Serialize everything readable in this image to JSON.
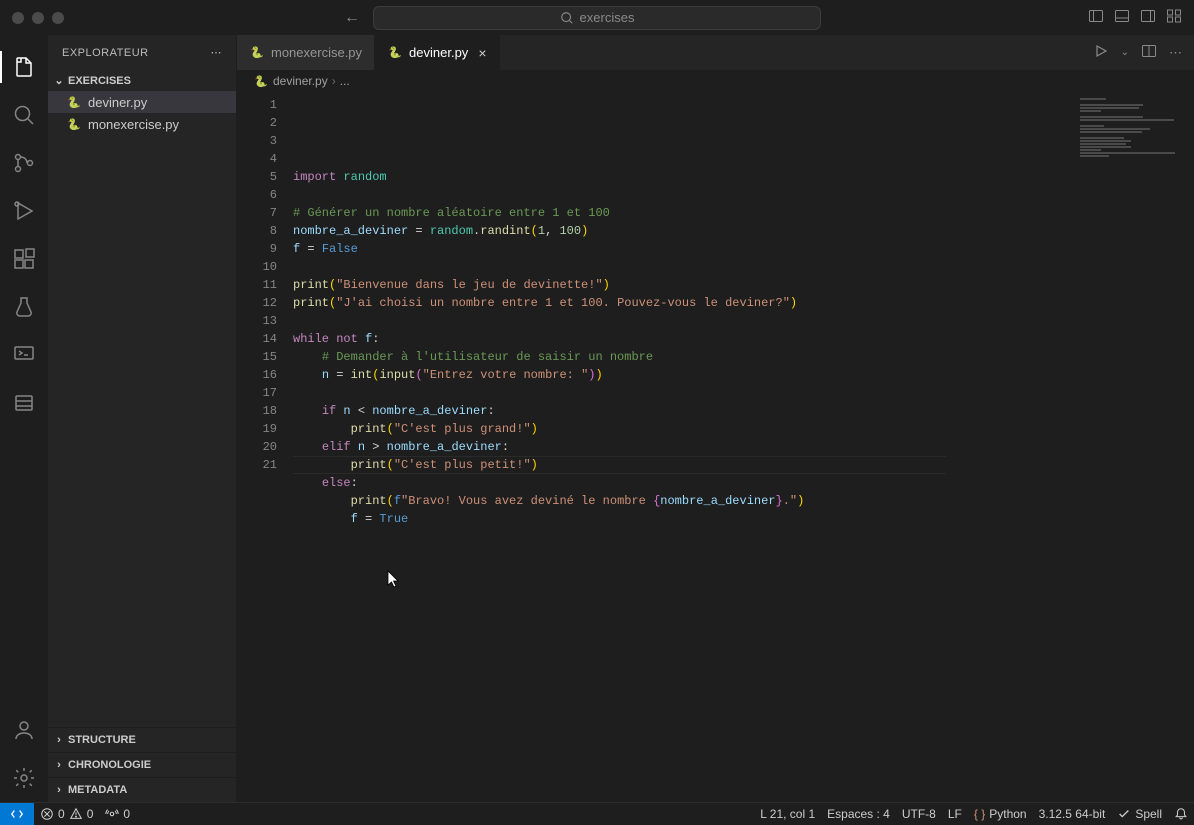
{
  "titlebar": {
    "search_placeholder": "exercises"
  },
  "sidebar": {
    "title": "EXPLORATEUR",
    "workspace": "EXERCISES",
    "files": [
      {
        "name": "deviner.py",
        "active": true
      },
      {
        "name": "monexercise.py",
        "active": false
      }
    ],
    "bottom_sections": [
      "STRUCTURE",
      "CHRONOLOGIE",
      "METADATA"
    ]
  },
  "tabs": [
    {
      "label": "monexercise.py",
      "active": false
    },
    {
      "label": "deviner.py",
      "active": true
    }
  ],
  "breadcrumbs": {
    "file": "deviner.py",
    "tail": "..."
  },
  "code": {
    "lines": [
      [
        [
          "kw",
          "import"
        ],
        [
          "plain",
          " "
        ],
        [
          "mod",
          "random"
        ]
      ],
      [],
      [
        [
          "cmt",
          "# Générer un nombre aléatoire entre 1 et 100"
        ]
      ],
      [
        [
          "var",
          "nombre_a_deviner"
        ],
        [
          "plain",
          " "
        ],
        [
          "op",
          "="
        ],
        [
          "plain",
          " "
        ],
        [
          "mod",
          "random"
        ],
        [
          "plain",
          "."
        ],
        [
          "fn",
          "randint"
        ],
        [
          "paren",
          "("
        ],
        [
          "num",
          "1"
        ],
        [
          "plain",
          ", "
        ],
        [
          "num",
          "100"
        ],
        [
          "paren",
          ")"
        ]
      ],
      [
        [
          "var",
          "f"
        ],
        [
          "plain",
          " "
        ],
        [
          "op",
          "="
        ],
        [
          "plain",
          " "
        ],
        [
          "bool",
          "False"
        ]
      ],
      [],
      [
        [
          "fn",
          "print"
        ],
        [
          "paren",
          "("
        ],
        [
          "str",
          "\"Bienvenue dans le jeu de devinette!\""
        ],
        [
          "paren",
          ")"
        ]
      ],
      [
        [
          "fn",
          "print"
        ],
        [
          "paren",
          "("
        ],
        [
          "str",
          "\"J'ai choisi un nombre entre 1 et 100. Pouvez-vous le deviner?\""
        ],
        [
          "paren",
          ")"
        ]
      ],
      [],
      [
        [
          "kw",
          "while"
        ],
        [
          "plain",
          " "
        ],
        [
          "kw",
          "not"
        ],
        [
          "plain",
          " "
        ],
        [
          "var",
          "f"
        ],
        [
          "plain",
          ":"
        ]
      ],
      [
        [
          "plain",
          "    "
        ],
        [
          "cmt",
          "# Demander à l'utilisateur de saisir un nombre"
        ]
      ],
      [
        [
          "plain",
          "    "
        ],
        [
          "var",
          "n"
        ],
        [
          "plain",
          " "
        ],
        [
          "op",
          "="
        ],
        [
          "plain",
          " "
        ],
        [
          "fn",
          "int"
        ],
        [
          "paren",
          "("
        ],
        [
          "fn",
          "input"
        ],
        [
          "paren2",
          "("
        ],
        [
          "str",
          "\"Entrez votre nombre: \""
        ],
        [
          "paren2",
          ")"
        ],
        [
          "paren",
          ")"
        ]
      ],
      [],
      [
        [
          "plain",
          "    "
        ],
        [
          "kw",
          "if"
        ],
        [
          "plain",
          " "
        ],
        [
          "var",
          "n"
        ],
        [
          "plain",
          " "
        ],
        [
          "op",
          "<"
        ],
        [
          "plain",
          " "
        ],
        [
          "var",
          "nombre_a_deviner"
        ],
        [
          "plain",
          ":"
        ]
      ],
      [
        [
          "plain",
          "        "
        ],
        [
          "fn",
          "print"
        ],
        [
          "paren",
          "("
        ],
        [
          "str",
          "\"C'est plus grand!\""
        ],
        [
          "paren",
          ")"
        ]
      ],
      [
        [
          "plain",
          "    "
        ],
        [
          "kw",
          "elif"
        ],
        [
          "plain",
          " "
        ],
        [
          "var",
          "n"
        ],
        [
          "plain",
          " "
        ],
        [
          "op",
          ">"
        ],
        [
          "plain",
          " "
        ],
        [
          "var",
          "nombre_a_deviner"
        ],
        [
          "plain",
          ":"
        ]
      ],
      [
        [
          "plain",
          "        "
        ],
        [
          "fn",
          "print"
        ],
        [
          "paren",
          "("
        ],
        [
          "str",
          "\"C'est plus petit!\""
        ],
        [
          "paren",
          ")"
        ]
      ],
      [
        [
          "plain",
          "    "
        ],
        [
          "kw",
          "else"
        ],
        [
          "plain",
          ":"
        ]
      ],
      [
        [
          "plain",
          "        "
        ],
        [
          "fn",
          "print"
        ],
        [
          "paren",
          "("
        ],
        [
          "bool",
          "f"
        ],
        [
          "str",
          "\"Bravo! Vous avez deviné le nombre "
        ],
        [
          "paren2",
          "{"
        ],
        [
          "var",
          "nombre_a_deviner"
        ],
        [
          "paren2",
          "}"
        ],
        [
          "str",
          ".\""
        ],
        [
          "paren",
          ")"
        ]
      ],
      [
        [
          "plain",
          "        "
        ],
        [
          "var",
          "f"
        ],
        [
          "plain",
          " "
        ],
        [
          "op",
          "="
        ],
        [
          "plain",
          " "
        ],
        [
          "bool",
          "True"
        ]
      ],
      []
    ]
  },
  "status": {
    "errors": "0",
    "warnings": "0",
    "ports": "0",
    "position": "L 21, col 1",
    "spaces": "Espaces : 4",
    "encoding": "UTF-8",
    "eol": "LF",
    "language": "Python",
    "version": "3.12.5 64-bit",
    "spell": "Spell"
  }
}
